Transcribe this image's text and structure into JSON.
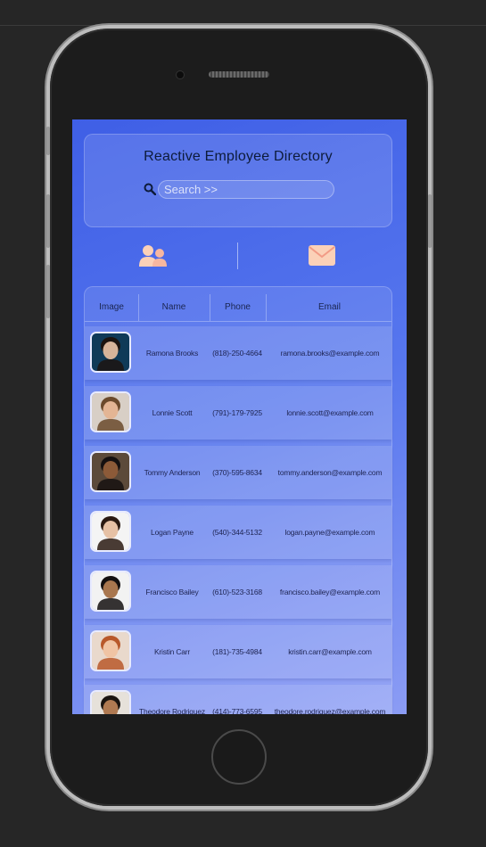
{
  "app": {
    "title": "Reactive Employee Directory",
    "search": {
      "placeholder": "Search >>",
      "value": ""
    }
  },
  "tabs": [
    {
      "name": "employees",
      "icon": "users-icon"
    },
    {
      "name": "email",
      "icon": "envelope-icon"
    }
  ],
  "table": {
    "headers": [
      "Image",
      "Name",
      "Phone",
      "Email"
    ],
    "rows": [
      {
        "name": "Ramona Brooks",
        "phone": "(818)-250-4664",
        "email": "ramona.brooks@example.com",
        "skin": "#d7b49a",
        "hair": "#1c1410",
        "bg": "#0f3a58"
      },
      {
        "name": "Lonnie Scott",
        "phone": "(791)-179-7925",
        "email": "lonnie.scott@example.com",
        "skin": "#e3b594",
        "hair": "#6b4a2c",
        "bg": "#d8cfc6"
      },
      {
        "name": "Tommy Anderson",
        "phone": "(370)-595-8634",
        "email": "tommy.anderson@example.com",
        "skin": "#8c5a38",
        "hair": "#151010",
        "bg": "#5c4a3a"
      },
      {
        "name": "Logan Payne",
        "phone": "(540)-344-5132",
        "email": "logan.payne@example.com",
        "skin": "#e6c1a5",
        "hair": "#2a1a12",
        "bg": "#f4f4f4"
      },
      {
        "name": "Francisco Bailey",
        "phone": "(610)-523-3168",
        "email": "francisco.bailey@example.com",
        "skin": "#a9774f",
        "hair": "#141010",
        "bg": "#f2f2f2"
      },
      {
        "name": "Kristin Carr",
        "phone": "(181)-735-4984",
        "email": "kristin.carr@example.com",
        "skin": "#f0c4a4",
        "hair": "#b8582a",
        "bg": "#e9d9cc"
      },
      {
        "name": "Theodore Rodriguez",
        "phone": "(414)-773-6595",
        "email": "theodore.rodriguez@example.com",
        "skin": "#b07a52",
        "hair": "#1a1410",
        "bg": "#e6e1da"
      }
    ]
  },
  "colors": {
    "accent": "#3f5fe6",
    "title_text": "#0d1b3a",
    "icon_peach": "#fbd1b8"
  }
}
